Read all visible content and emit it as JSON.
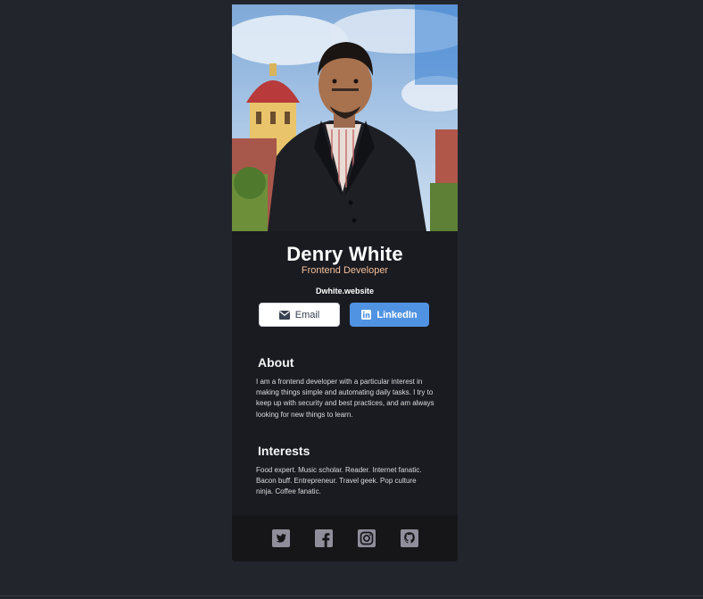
{
  "profile": {
    "name": "Denry White",
    "title": "Frontend Developer",
    "website": "Dwhite.website"
  },
  "buttons": {
    "email_label": "Email",
    "linkedin_label": "LinkedIn"
  },
  "about": {
    "heading": "About",
    "text": "I am a frontend developer with a particular interest in making things simple and automating daily tasks. I try to keep up with security and best practices, and am always looking for new things to learn."
  },
  "interests": {
    "heading": "Interests",
    "text": "Food expert. Music scholar. Reader. Internet fanatic. Bacon buff. Entrepreneur. Travel geek. Pop culture ninja. Coffee fanatic."
  },
  "footer": {
    "icons": [
      "twitter-icon",
      "facebook-icon",
      "instagram-icon",
      "github-icon"
    ]
  },
  "colors": {
    "background": "#23252c",
    "card": "#1a1b21",
    "footer": "#161619",
    "accent_title": "#f3bf99",
    "linkedin": "#5093e2",
    "social_icon": "#918e9b"
  }
}
